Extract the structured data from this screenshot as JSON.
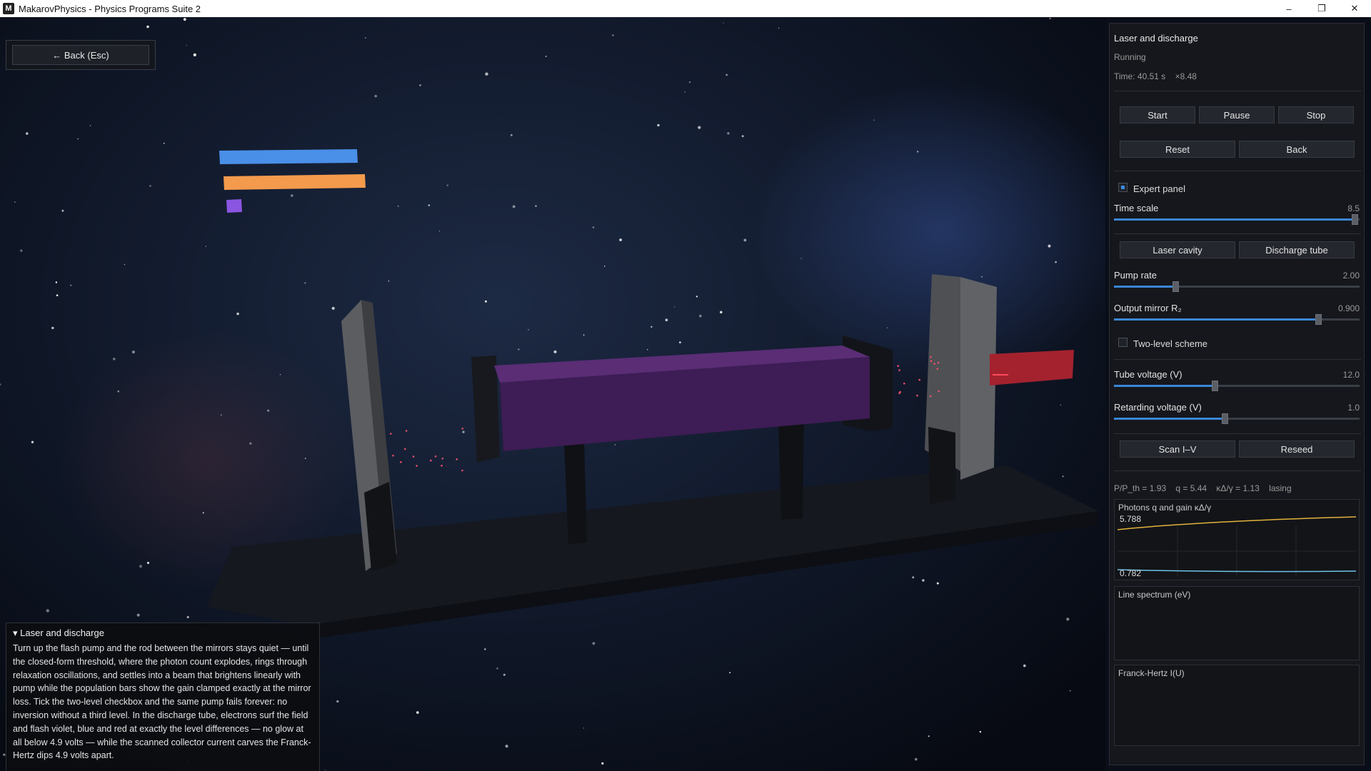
{
  "window": {
    "icon_letter": "M",
    "title": "MakarovPhysics - Physics Programs Suite 2",
    "minimize_glyph": "–",
    "maximize_glyph": "❐",
    "close_glyph": "✕"
  },
  "nav": {
    "back_label": "←  Back  (Esc)"
  },
  "info": {
    "title": "▾ Laser and discharge",
    "text": "Turn up the flash pump and the rod between the mirrors stays quiet — until the closed-form threshold, where the photon count explodes, rings through relaxation oscillations, and settles into a beam that brightens linearly with pump while the population bars show the gain clamped exactly at the mirror loss. Tick the two-level checkbox and the same pump fails forever: no inversion without a third level. In the discharge tube, electrons surf the field and flash violet, blue and red at exactly the level differences — no glow at all below 4.9 volts — while the scanned collector current carves the Franck-Hertz dips 4.9 volts apart."
  },
  "panel": {
    "title": "Laser and discharge",
    "status": "Running",
    "time_text": "Time: 40.51 s    ×8.48",
    "buttons": {
      "start": "Start",
      "pause": "Pause",
      "stop": "Stop",
      "reset": "Reset",
      "back": "Back"
    },
    "expert_panel": {
      "label": "Expert panel",
      "checked": true
    },
    "time_scale": {
      "label": "Time scale",
      "value_text": "8.5",
      "fraction": 0.98
    },
    "tabs": {
      "laser": "Laser cavity",
      "discharge": "Discharge tube"
    },
    "pump_rate": {
      "label": "Pump rate",
      "value_text": "2.00",
      "fraction": 0.25
    },
    "output_mirror": {
      "label": "Output mirror R₂",
      "value_text": "0.900",
      "fraction": 0.83
    },
    "two_level": {
      "label": "Two-level scheme",
      "checked": false
    },
    "tube_voltage": {
      "label": "Tube voltage (V)",
      "value_text": "12.0",
      "fraction": 0.41
    },
    "retarding_voltage": {
      "label": "Retarding voltage (V)",
      "value_text": "1.0",
      "fraction": 0.45
    },
    "action_buttons": {
      "scan": "Scan I–V",
      "reseed": "Reseed"
    },
    "readout": "P/P_th = 1.93    q = 5.44    κΔ/γ = 1.13    lasing",
    "plots": {
      "photons": {
        "title": "Photons q and gain κΔ/γ",
        "max_label": "5.788",
        "min_label": "0.782"
      },
      "spectrum": {
        "title": "Line spectrum (eV)"
      },
      "franck_hertz": {
        "title": "Franck-Hertz I(U)"
      }
    }
  },
  "colors": {
    "accent": "#3b86d6",
    "photon_line": "#e3b23c",
    "gain_line": "#6ec3e8",
    "population_bar_1": "#4a8fe8",
    "population_bar_2": "#f39a4c",
    "population_bar_3": "#8a55e0",
    "laser_rod": "#4c2466",
    "beam": "#a3222e"
  }
}
